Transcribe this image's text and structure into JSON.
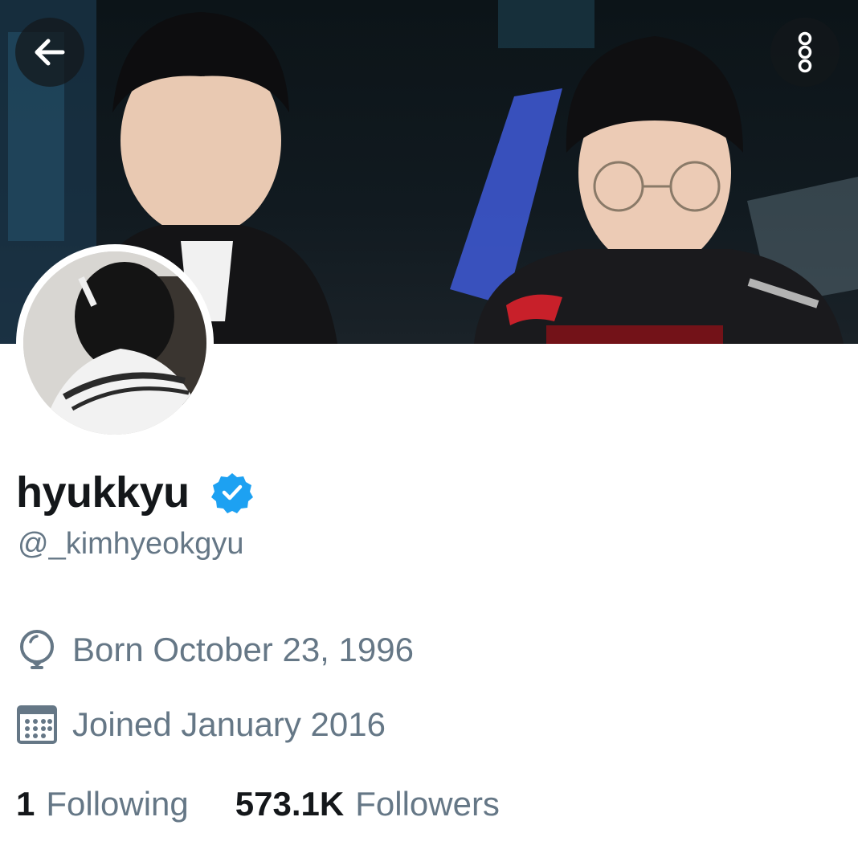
{
  "header": {
    "back_icon": "arrow-left-icon",
    "more_icon": "more-vertical-icon",
    "button_bg": "#14171ab8"
  },
  "profile": {
    "display_name": "hyukkyu",
    "verified": true,
    "verified_color": "#1da1f2",
    "handle": "@_kimhyeokgyu",
    "birth": "Born October 23, 1996",
    "joined": "Joined January 2016",
    "following_count": "1",
    "following_label": "Following",
    "followers_count": "573.1K",
    "followers_label": "Followers"
  },
  "colors": {
    "primary_text": "#14171a",
    "secondary_text": "#657786",
    "background": "#ffffff"
  }
}
